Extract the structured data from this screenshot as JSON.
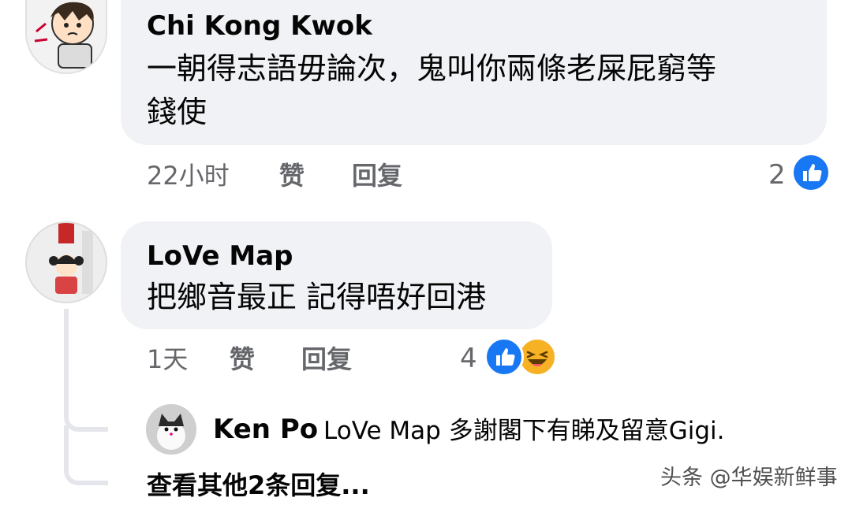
{
  "comments": [
    {
      "author": "Chi Kong Kwok",
      "text_line1": "一朝得志語毋論次，鬼叫你兩條老屎屁窮等",
      "text_line2": "錢使",
      "time": "22小时",
      "like_label": "赞",
      "reply_label": "回复",
      "reaction_count": "2",
      "reactions": [
        "like-icon"
      ]
    },
    {
      "author": "LoVe Map",
      "text": "把鄉音最正 記得唔好回港",
      "time": "1天",
      "like_label": "赞",
      "reply_label": "回复",
      "reaction_count": "4",
      "reactions": [
        "like-icon",
        "haha-icon"
      ],
      "reply": {
        "author": "Ken Po",
        "text": "LoVe Map 多謝閣下有睇及留意Gigi."
      },
      "more_replies": "查看其他2条回复..."
    }
  ],
  "watermark": "头条 @华娱新鲜事",
  "colors": {
    "bubble": "#f0f2f5",
    "meta": "#65676b",
    "like_blue": "#1877f2",
    "haha_yellow": "#f7b125"
  }
}
